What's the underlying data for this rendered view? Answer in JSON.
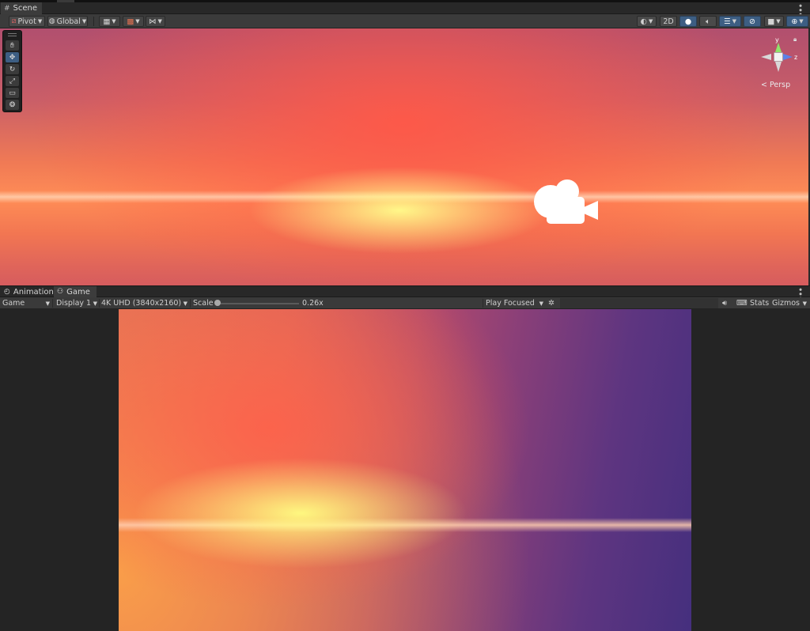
{
  "scene": {
    "tab_label": "Scene",
    "toolbar": {
      "pivot_label": "Pivot",
      "global_label": "Global",
      "mode_2d_label": "2D"
    },
    "tools": [
      "hand-tool",
      "move-tool",
      "rotate-tool",
      "scale-tool",
      "rect-tool",
      "transform-tool"
    ],
    "selected_tool": "move-tool",
    "gizmo": {
      "y_axis_label": "y",
      "z_axis_label": "z",
      "projection_label": "Persp",
      "y_color": "#8fe36a",
      "z_color": "#5b82e8"
    }
  },
  "game": {
    "tabs": [
      {
        "label": "Animation",
        "icon": "clock-icon"
      },
      {
        "label": "Game",
        "icon": "gamepad-icon"
      }
    ],
    "active_tab": "Game",
    "toolbar": {
      "view_select": "Game",
      "display_select": "Display 1",
      "resolution_select": "4K UHD (3840x2160)",
      "scale_label": "Scale",
      "scale_value": "0.26x",
      "scale_fraction": 0.02,
      "play_mode_select": "Play Focused",
      "stats_label": "Stats",
      "gizmos_label": "Gizmos"
    }
  }
}
